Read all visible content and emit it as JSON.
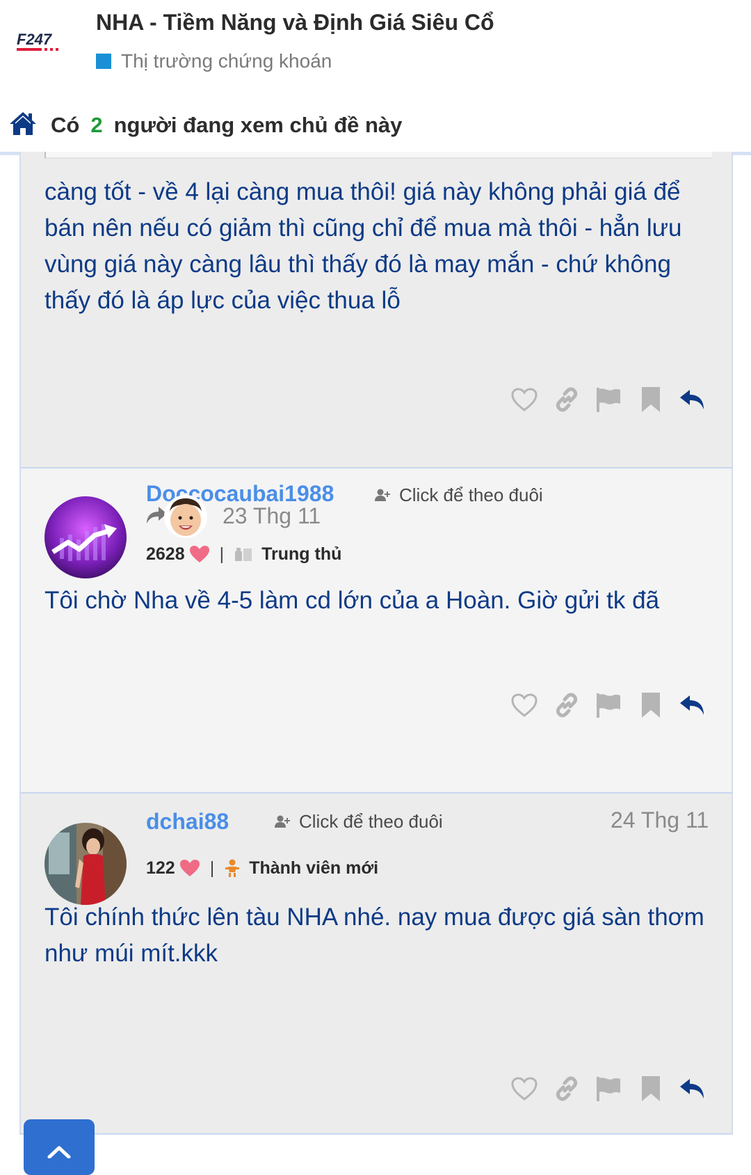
{
  "header": {
    "logo_text": "F247",
    "thread_title": "NHA - Tiềm Năng và Định Giá Siêu Cổ",
    "forum_name": "Thị trường chứng khoán",
    "colors": {
      "forum_square": "#1a8fd6",
      "logo_dark": "#1e2a4a",
      "logo_red": "#e01e3c"
    }
  },
  "viewers": {
    "prefix": "Có",
    "count": "2",
    "suffix": "người đang xem chủ đề này",
    "icon": "home-icon"
  },
  "posts": [
    {
      "body": "càng tốt - về 4 lại càng mua thôi! giá này không phải giá để bán nên nếu có giảm thì cũng chỉ để mua mà thôi - hẳn lưu vùng giá này càng lâu thì thấy đó là may mắn - chứ không thấy đó là áp lực của việc thua lỗ"
    },
    {
      "username": "Doccocaubai1988",
      "follow_label": "Click để theo đuôi",
      "date": "23 Thg 11",
      "likes": "2628",
      "rank": "Trung thủ",
      "body": "Tôi chờ Nha về 4-5 làm cd lớn của a Hoàn. Giờ gửi tk đã"
    },
    {
      "username": "dchai88",
      "follow_label": "Click để theo đuôi",
      "date": "24 Thg 11",
      "likes": "122",
      "rank": "Thành viên mới",
      "body": "Tôi chính thức lên tàu NHA nhé. nay mua được giá sàn thơm như múi mít.kkk"
    }
  ],
  "actions": [
    "like-icon",
    "link-icon",
    "flag-icon",
    "bookmark-icon",
    "reply-icon"
  ],
  "colors": {
    "post_text": "#0d3a86",
    "username": "#4a8ee8",
    "heart": "#f06b85",
    "accent_blue": "#2e6fd0"
  }
}
